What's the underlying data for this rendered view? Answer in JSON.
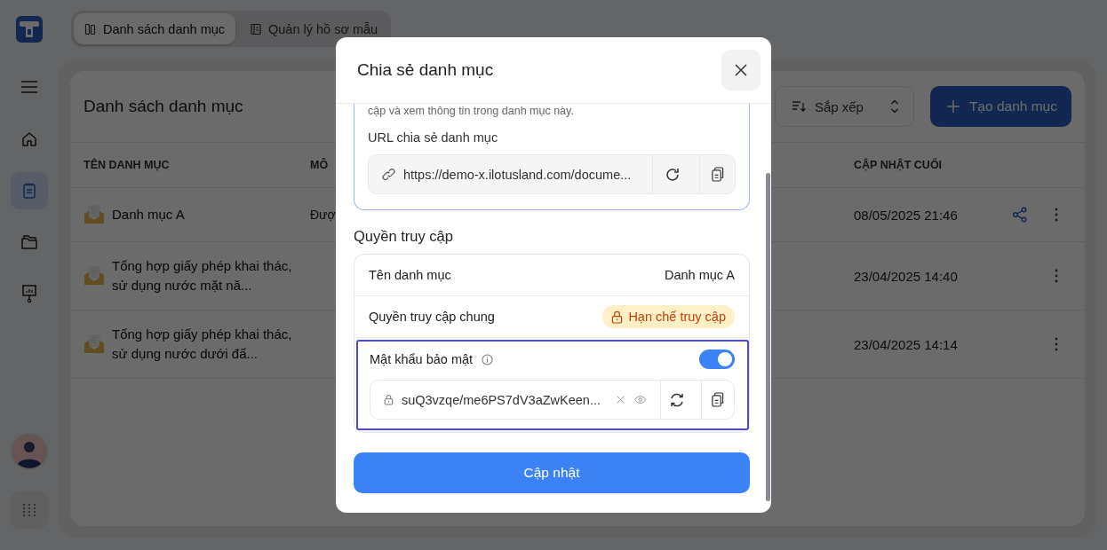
{
  "sidebar": {
    "nav_items": [
      {
        "selected": false
      },
      {
        "selected": true
      },
      {
        "selected": false
      },
      {
        "selected": false
      }
    ]
  },
  "tabs": [
    {
      "label": "Danh sách danh mục",
      "selected": true
    },
    {
      "label": "Quản lý hồ sơ mẫu",
      "selected": false
    }
  ],
  "page": {
    "title": "Danh sách danh mục",
    "sort_label": "Sắp xếp",
    "create_button": "Tạo danh mục"
  },
  "table": {
    "columns": [
      "TÊN DANH MỤC",
      "MÔ",
      "CẬP NHẬT CUỐI"
    ],
    "rows": [
      {
        "name": "Danh mục A",
        "description": "Đượ",
        "updated": "08/05/2025 21:46",
        "shared": true
      },
      {
        "name": "Tổng hợp giấy phép khai thác, sử dụng nước mặt nă...",
        "updated": "23/04/2025 14:40",
        "shared": false
      },
      {
        "name": "Tổng hợp giấy phép khai thác, sử dụng nước dưới đấ...",
        "updated": "23/04/2025 14:14",
        "shared": false
      }
    ]
  },
  "modal": {
    "title": "Chia sẻ danh mục",
    "intro_tail": "cập và xem thông tin trong danh mục này.",
    "url_label": "URL chia sẻ danh mục",
    "url_value": "https://demo-x.ilotusland.com/docume...",
    "access_heading": "Quyền truy cập",
    "name_label": "Tên danh mục",
    "name_value": "Danh mục A",
    "general_label": "Quyền truy cập chung",
    "general_badge": "Hạn chế truy cập",
    "password": {
      "label": "Mật khẩu bảo mật",
      "on": true,
      "highlighted": true,
      "value": "suQ3vzqe/me6PS7dV3aZwKeen..."
    },
    "submit": "Cập nhật"
  }
}
